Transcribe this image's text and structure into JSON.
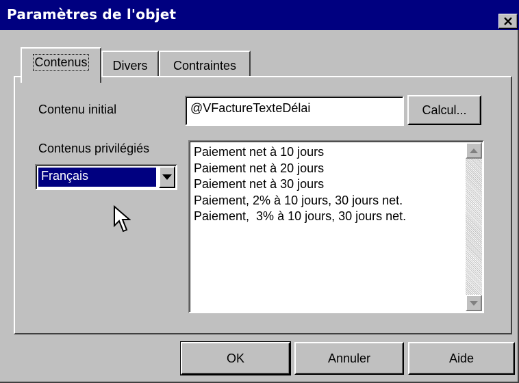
{
  "window": {
    "title": "Paramètres de l'objet"
  },
  "tabs": [
    {
      "label": "Contenus",
      "active": true
    },
    {
      "label": "Divers",
      "active": false
    },
    {
      "label": "Contraintes",
      "active": false
    }
  ],
  "form": {
    "initial_content_label": "Contenu initial",
    "initial_content_value": "@VFactureTexteDélai",
    "calc_button": "Calcul...",
    "privileged_label": "Contenus privilégiés",
    "language_selected": "Français",
    "privileged_items": [
      "Paiement net à 10 jours",
      "Paiement net à 20 jours",
      "Paiement net à 30 jours",
      "Paiement, 2% à 10 jours, 30 jours net.",
      "Paiement,  3% à 10 jours, 30 jours net."
    ]
  },
  "footer": {
    "ok": "OK",
    "cancel": "Annuler",
    "help": "Aide"
  },
  "icons": {
    "close": "close-icon",
    "dropdown": "chevron-down-icon",
    "scroll_up": "scroll-up-icon",
    "scroll_down": "scroll-down-icon",
    "cursor": "mouse-pointer-icon"
  },
  "colors": {
    "titlebar": "#000080",
    "face": "#c0c0c0",
    "selection": "#000080"
  }
}
